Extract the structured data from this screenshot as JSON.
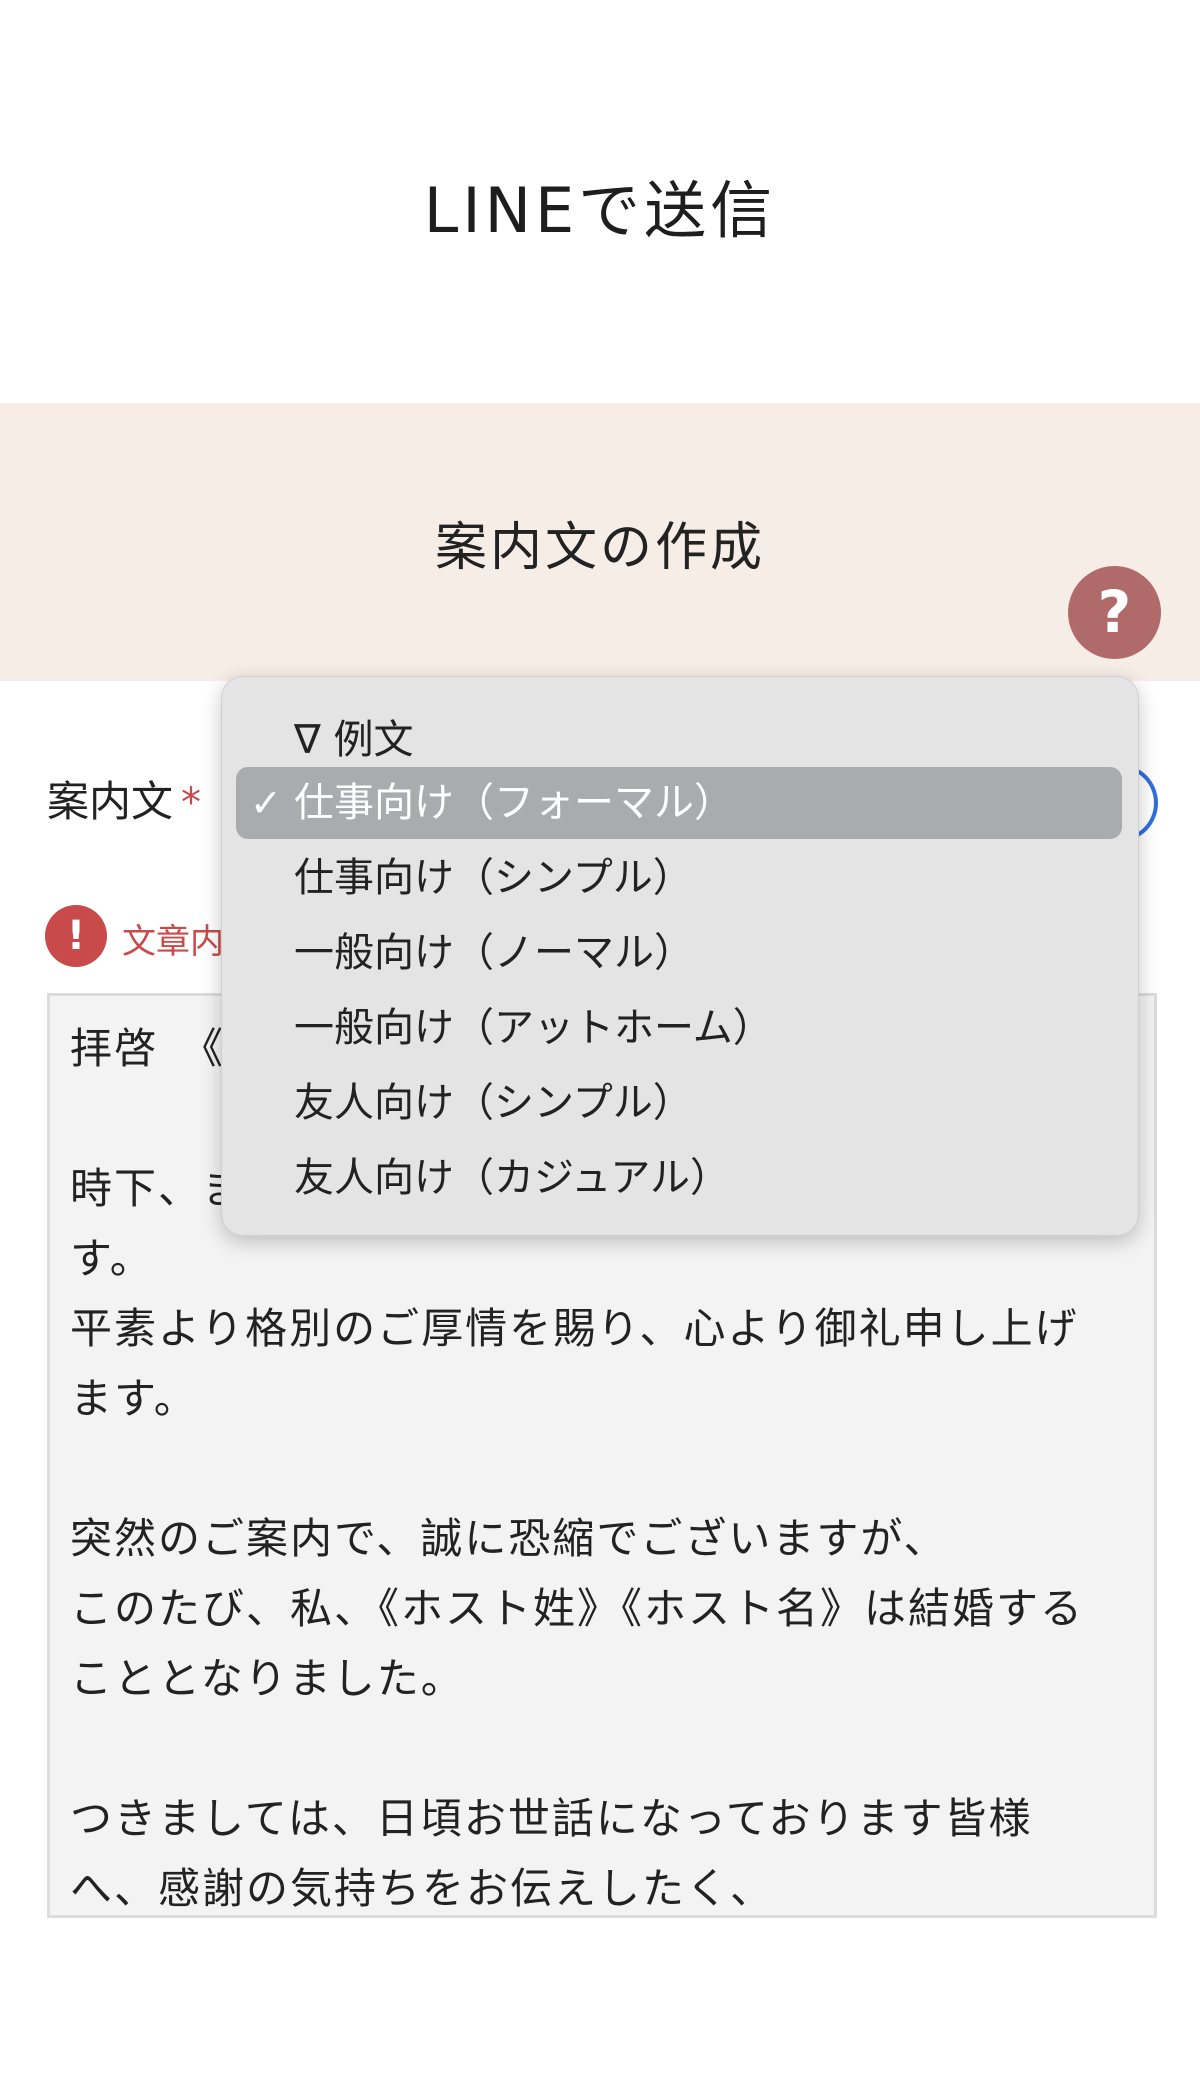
{
  "page": {
    "title": "LINEで送信"
  },
  "section": {
    "title": "案内文の作成",
    "help_icon": "?"
  },
  "field": {
    "label": "案内文",
    "required_mark": "*"
  },
  "error": {
    "icon": "!",
    "text": "文章内"
  },
  "dropdown": {
    "group_label": "∇ 例文",
    "check_icon": "✓",
    "selected_index": 0,
    "options": [
      "仕事向け（フォーマル）",
      "仕事向け（シンプル）",
      "一般向け（ノーマル）",
      "一般向け（アットホーム）",
      "友人向け（シンプル）",
      "友人向け（カジュアル）"
    ]
  },
  "message": {
    "lines": [
      "拝啓　《",
      "",
      "時下、ま",
      "す。",
      "平素より格別のご厚情を賜り、心より御礼申し上げ",
      "ます。",
      "",
      "突然のご案内で、誠に恐縮でございますが、",
      "このたび、私、《ホスト姓》《ホスト名》は結婚する",
      "こととなりました。",
      "",
      "つきましては、日頃お世話になっております皆様",
      "へ、感謝の気持ちをお伝えしたく、"
    ]
  },
  "colors": {
    "accent_red": "#c94a4a",
    "help_button": "#b06a6a",
    "band": "#f6ede6",
    "focus_blue": "#2f6fdd"
  }
}
